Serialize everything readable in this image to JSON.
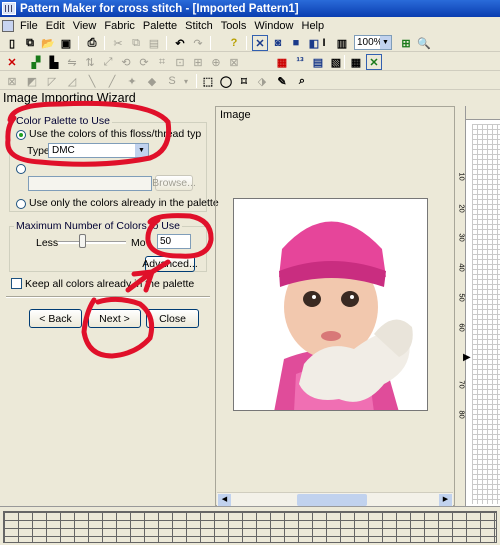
{
  "window": {
    "title": "Pattern Maker for cross stitch - [Imported Pattern1]"
  },
  "menu": [
    "File",
    "Edit",
    "View",
    "Fabric",
    "Palette",
    "Stitch",
    "Tools",
    "Window",
    "Help"
  ],
  "toolbar": {
    "zoom_value": "100%"
  },
  "wizard": {
    "title": "Image Importing Wizard",
    "palette_group": "Color Palette to Use",
    "opt_floss": "Use the colors of this floss/thread typ",
    "type_label": "Type:",
    "type_value": "DMC",
    "browse": "Browse...",
    "opt_palette": "Use only the colors already in the palette",
    "max_group": "Maximum Number of Colors to Use",
    "less": "Less",
    "more": "Mo",
    "max_value": "50",
    "slider_level": 0.35,
    "advanced": "Advanced...",
    "keep_label": "Keep all colors already in the palette",
    "back": "< Back",
    "next": "Next >",
    "close": "Close"
  },
  "image_panel": {
    "label": "Image"
  },
  "ruler": {
    "labels": [
      "10",
      "20",
      "30",
      "40",
      "50",
      "60",
      "70",
      "80"
    ]
  },
  "colors": {
    "annotation": "#e0102a",
    "titlebar": "#0a3db0"
  }
}
